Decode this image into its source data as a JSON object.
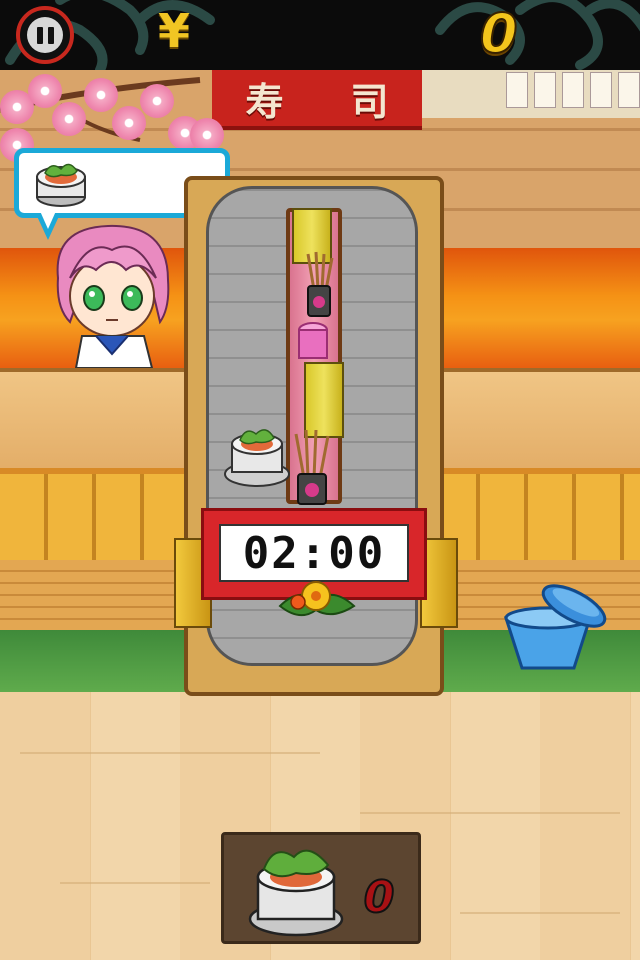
{
  "hud": {
    "currency_symbol": "¥",
    "money": "0",
    "pause_icon": "pause-icon"
  },
  "signage": {
    "noren_left": "寿",
    "noren_right": "司"
  },
  "order": {
    "item_icon": "sushi-roll-icon"
  },
  "timer": {
    "value": "02:00"
  },
  "plate_tray": {
    "item_icon": "sushi-roll-icon",
    "count": "0"
  },
  "colors": {
    "hud_bg": "#0b0b0b",
    "accent_red": "#c8231d",
    "bubble_border": "#1ba9d8",
    "gold": "#f4c51c"
  }
}
